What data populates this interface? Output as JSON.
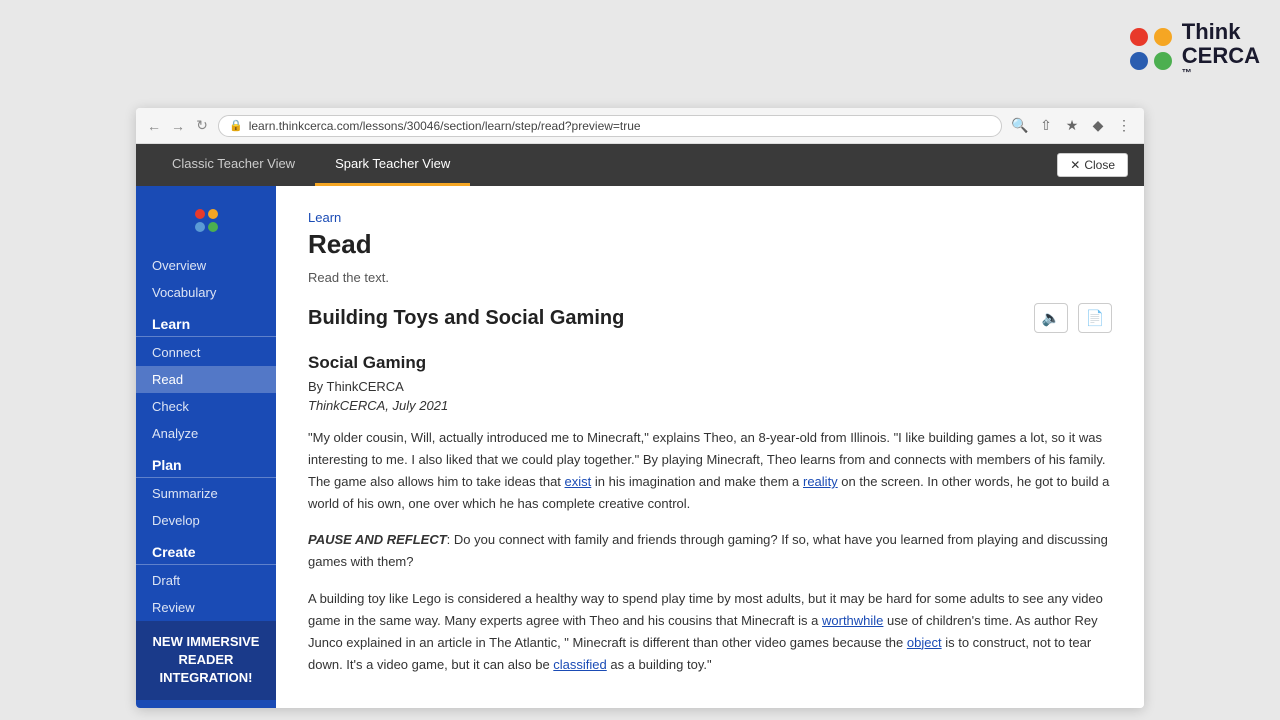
{
  "logo": {
    "think": "Think",
    "cerca": "CERCA",
    "tm": "™"
  },
  "browser": {
    "url": "learn.thinkcerca.com/lessons/30046/section/learn/step/read?preview=true"
  },
  "teacher_tabs": {
    "classic": "Classic Teacher View",
    "spark": "Spark Teacher View",
    "active": "spark",
    "close_label": "Close"
  },
  "sidebar": {
    "overview": "Overview",
    "vocabulary": "Vocabulary",
    "learn_label": "Learn",
    "connect": "Connect",
    "read": "Read",
    "check": "Check",
    "analyze": "Analyze",
    "plan_label": "Plan",
    "summarize": "Summarize",
    "develop": "Develop",
    "create_label": "Create",
    "draft": "Draft",
    "review": "Review",
    "promo": "NEW IMMERSIVE READER INTEGRATION!"
  },
  "content": {
    "section_label": "Learn",
    "page_title": "Read",
    "instruction": "Read the text.",
    "article_title": "Building Toys and Social Gaming",
    "article_section": "Social Gaming",
    "byline": "By ThinkCERCA",
    "date": "ThinkCERCA, July 2021",
    "para1": "\"My older cousin, Will, actually introduced me to Minecraft,\" explains Theo, an 8-year-old from Illinois. \"I like building games a lot, so it was interesting to me. I also liked that we could play together.\" By playing Minecraft, Theo learns from and connects with members of his family. The game also allows him to take ideas that exist in his imagination and make them a reality on the screen. In other words, he got to build a world of his own, one over which he has complete creative control.",
    "para1_exist": "exist",
    "para1_reality": "reality",
    "pause_label": "PAUSE AND REFLECT",
    "para2_reflect": ": Do you connect with family and friends through gaming? If so, what have you learned from playing and discussing games with them?",
    "para3": "A building toy like Lego is considered a healthy way to spend play time by most adults, but it may be hard for some adults to see any video game in the same way. Many experts agree with Theo and his cousins that Minecraft is a worthwhile use of children's time. As author Rey Junco explained in an article in The Atlantic, \" Minecraft is different than other video games because the object is to construct, not to tear down. It's a video game, but it can also be classified as a building toy.\"",
    "para3_worthwhile": "worthwhile",
    "para3_object": "object",
    "para3_classified": "classified"
  }
}
